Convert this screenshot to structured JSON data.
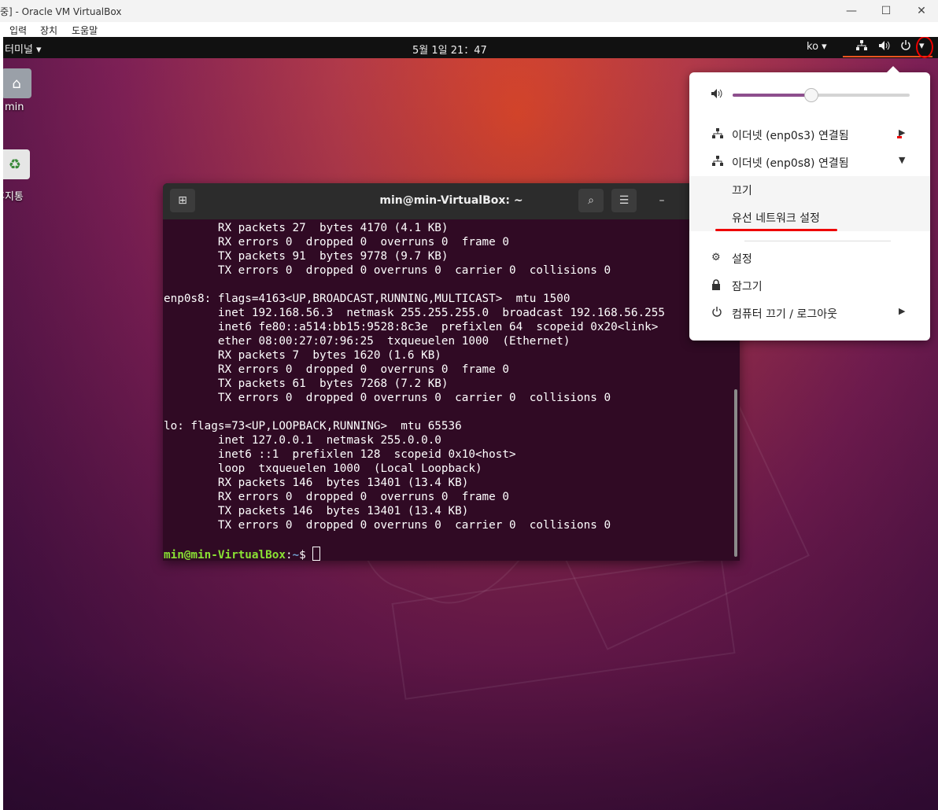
{
  "host": {
    "title": "중] - Oracle VM VirtualBox",
    "minimize": "—",
    "maximize": "☐",
    "close": "✕",
    "menu": [
      "입력",
      "장치",
      "도움말"
    ]
  },
  "topbar": {
    "app_menu": "터미널 ▾",
    "clock": "5월 1일  21：47",
    "lang": "ko ▾",
    "network_icon": "network-icon",
    "volume_icon": "volume-icon",
    "power_icon": "power-icon",
    "dropdown_icon": "▾"
  },
  "desktop": {
    "home_label": "min",
    "trash_label": "휴지통"
  },
  "terminal": {
    "title": "min@min-VirtualBox: ~",
    "new_tab": "⊞",
    "search": "⌕",
    "menu": "☰",
    "minimize": "–",
    "lines": [
      "        RX packets 27  bytes 4170 (4.1 KB)",
      "        RX errors 0  dropped 0  overruns 0  frame 0",
      "        TX packets 91  bytes 9778 (9.7 KB)",
      "        TX errors 0  dropped 0 overruns 0  carrier 0  collisions 0",
      "",
      "enp0s8: flags=4163<UP,BROADCAST,RUNNING,MULTICAST>  mtu 1500",
      "        inet 192.168.56.3  netmask 255.255.255.0  broadcast 192.168.56.255",
      "        inet6 fe80::a514:bb15:9528:8c3e  prefixlen 64  scopeid 0x20<link>",
      "        ether 08:00:27:07:96:25  txqueuelen 1000  (Ethernet)",
      "        RX packets 7  bytes 1620 (1.6 KB)",
      "        RX errors 0  dropped 0  overruns 0  frame 0",
      "        TX packets 61  bytes 7268 (7.2 KB)",
      "        TX errors 0  dropped 0 overruns 0  carrier 0  collisions 0",
      "",
      "lo: flags=73<UP,LOOPBACK,RUNNING>  mtu 65536",
      "        inet 127.0.0.1  netmask 255.0.0.0",
      "        inet6 ::1  prefixlen 128  scopeid 0x10<host>",
      "        loop  txqueuelen 1000  (Local Loopback)",
      "        RX packets 146  bytes 13401 (13.4 KB)",
      "        RX errors 0  dropped 0  overruns 0  frame 0",
      "        TX packets 146  bytes 13401 (13.4 KB)",
      "        TX errors 0  dropped 0 overruns 0  carrier 0  collisions 0",
      ""
    ],
    "prompt_user": "min@min-VirtualBox",
    "prompt_sep": ":",
    "prompt_path": "~",
    "prompt_end": "$ "
  },
  "menu": {
    "volume_level": 0.44,
    "items": [
      {
        "icon": "network-icon",
        "label": "이더넷 (enp0s3) 연결됨",
        "arrow": "▶"
      },
      {
        "icon": "network-icon",
        "label": "이더넷 (enp0s8) 연결됨",
        "arrow": "▼"
      },
      {
        "label": "끄기"
      },
      {
        "label": "유선 네트워크 설정"
      },
      {
        "icon": "gear-icon",
        "label": "설정"
      },
      {
        "icon": "lock-icon",
        "label": "잠그기"
      },
      {
        "icon": "power-icon",
        "label": "컴퓨터 끄기 / 로그아웃",
        "arrow": "▶"
      }
    ]
  }
}
